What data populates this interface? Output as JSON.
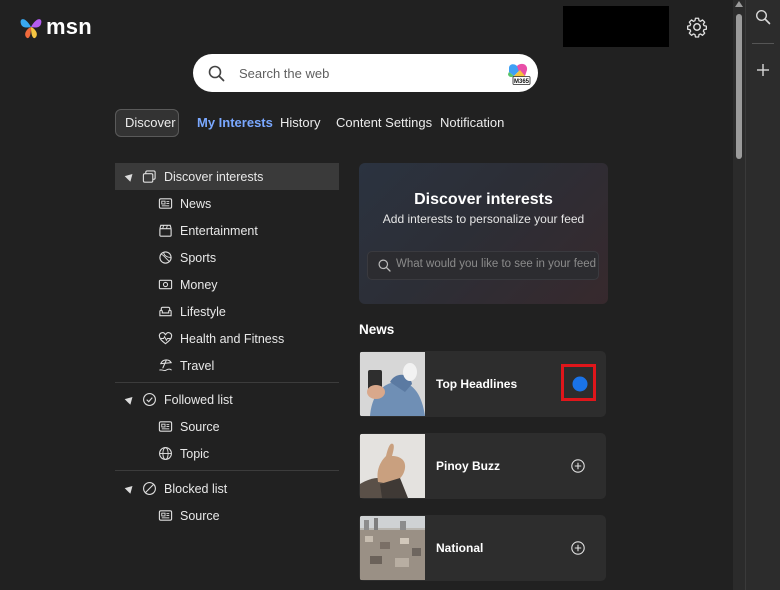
{
  "brand": {
    "name": "msn"
  },
  "search": {
    "placeholder": "Search the web",
    "copilot_badge": "M365"
  },
  "tabs": [
    {
      "label": "Discover"
    },
    {
      "label": "My Interests"
    },
    {
      "label": "History"
    },
    {
      "label": "Content Settings"
    },
    {
      "label": "Notification"
    }
  ],
  "sidebar": {
    "discover": {
      "label": "Discover interests",
      "items": [
        {
          "label": "News",
          "icon": "newspaper-icon"
        },
        {
          "label": "Entertainment",
          "icon": "clapperboard-icon"
        },
        {
          "label": "Sports",
          "icon": "sports-icon"
        },
        {
          "label": "Money",
          "icon": "money-icon"
        },
        {
          "label": "Lifestyle",
          "icon": "sofa-icon"
        },
        {
          "label": "Health and Fitness",
          "icon": "heart-pulse-icon"
        },
        {
          "label": "Travel",
          "icon": "travel-icon"
        }
      ]
    },
    "followed": {
      "label": "Followed list",
      "items": [
        {
          "label": "Source",
          "icon": "newspaper-icon"
        },
        {
          "label": "Topic",
          "icon": "globe-icon"
        }
      ]
    },
    "blocked": {
      "label": "Blocked list",
      "items": [
        {
          "label": "Source",
          "icon": "newspaper-icon"
        }
      ]
    }
  },
  "hero": {
    "title": "Discover interests",
    "subtitle": "Add interests to personalize your feed",
    "search_placeholder": "What would you like to see in your feed?"
  },
  "news_section": {
    "title": "News",
    "cards": [
      {
        "title": "Top Headlines",
        "followed": true
      },
      {
        "title": "Pinoy Buzz",
        "followed": false
      },
      {
        "title": "National",
        "followed": false
      }
    ]
  },
  "colors": {
    "accent": "#7aa8ff",
    "check_blue": "#1a73e8",
    "highlight_red": "#e0161b"
  }
}
